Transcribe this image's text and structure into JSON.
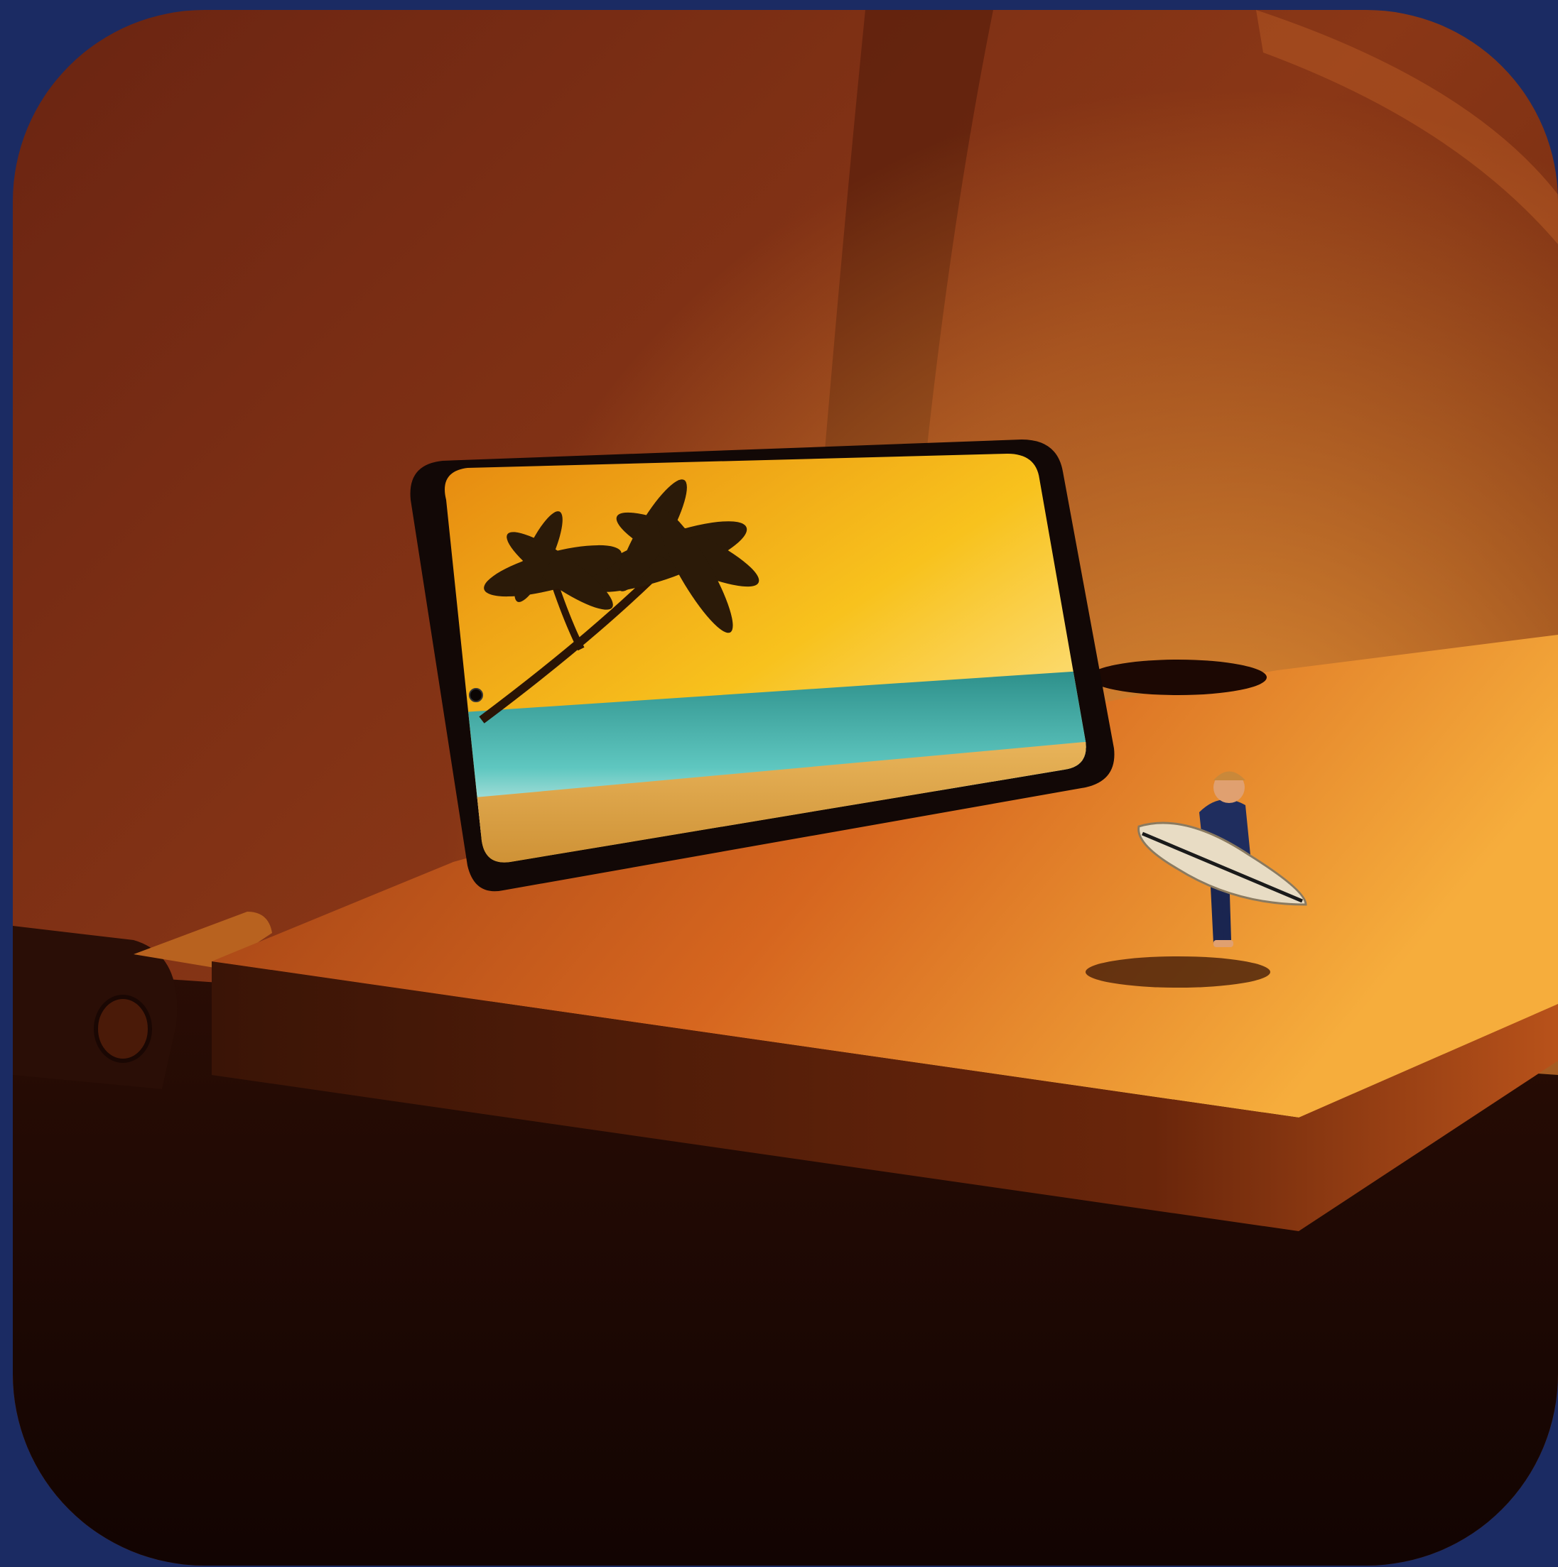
{
  "image": {
    "kind": "photograph",
    "subject": [
      "smartphone",
      "miniature-surfer-figurine",
      "airplane-tray-table"
    ],
    "frame_color": "#1b2b63",
    "palette": {
      "cabin_wall": "#7a2f16",
      "tray_top": "#d86a22",
      "tray_highlight": "#f4a13a",
      "shadow": "#1a0804",
      "screen_sky": "#f7b11c",
      "screen_sea": "#2fa3a0"
    }
  }
}
